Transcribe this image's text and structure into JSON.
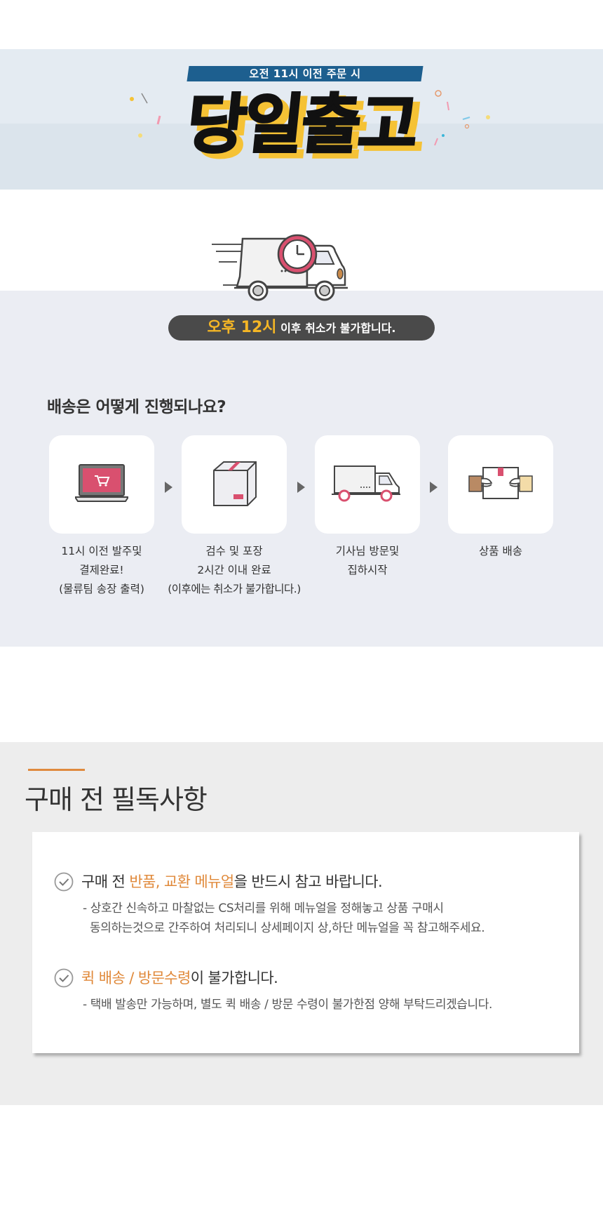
{
  "banner": {
    "subtitle": "오전 11시 이전 주문 시",
    "title": "당일출고"
  },
  "cancel_notice": {
    "time": "오후 12시",
    "rest": " 이후 취소가 불가합니다."
  },
  "process": {
    "heading": "배송은 어떻게 진행되나요?",
    "steps": [
      {
        "icon": "laptop-cart-icon",
        "lines": [
          "11시 이전 발주및",
          "결제완료!",
          "(물류팀 송장 출력)"
        ]
      },
      {
        "icon": "box-icon",
        "lines": [
          "검수 및 포장",
          "2시간 이내 완료",
          "(이후에는 취소가 불가합니다.)"
        ]
      },
      {
        "icon": "delivery-truck-icon",
        "lines": [
          "기사님 방문및",
          "집하시작",
          ""
        ]
      },
      {
        "icon": "package-handover-icon",
        "lines": [
          "상품 배송",
          "",
          ""
        ]
      }
    ]
  },
  "notice": {
    "title": "구매 전 필독사항",
    "items": [
      {
        "head_pre": "구매 전 ",
        "head_hl": "반품, 교환 메뉴얼",
        "head_post": "을 반드시 참고 바랍니다.",
        "desc": "- 상호간 신속하고 마찰없는 CS처리를 위해 메뉴얼을 정해놓고 상품 구매시\n  동의하는것으로 간주하여 처리되니 상세페이지 상,하단 메뉴얼을 꼭 참고해주세요."
      },
      {
        "head_pre": "",
        "head_hl": "퀵 배송 / 방문수령",
        "head_post": "이 불가합니다.",
        "desc": "- 택배 발송만 가능하며, 별도 퀵 배송 / 방문 수령이 불가한점 양해 부탁드리겠습니다."
      }
    ]
  },
  "colors": {
    "accent_orange": "#e0893a",
    "highlight_yellow": "#f5b625",
    "banner_blue": "#1d5f8f",
    "pink": "#d9506f"
  }
}
